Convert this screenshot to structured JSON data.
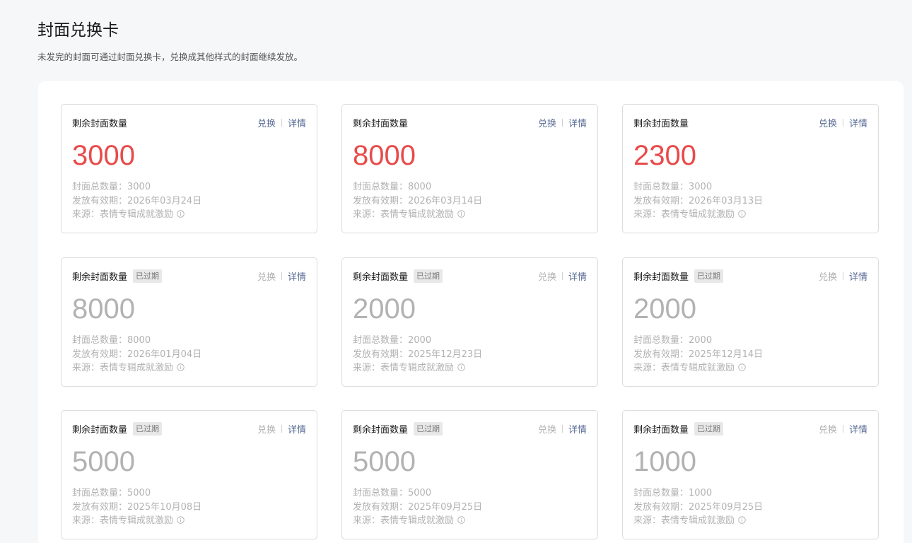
{
  "header": {
    "title": "封面兑换卡",
    "subtitle": "未发完的封面可通过封面兑换卡，兑换成其他样式的封面继续发放。"
  },
  "cards": [
    {
      "label": "剩余封面数量",
      "expired": false,
      "remaining": "3000",
      "exchange": "兑换",
      "details": "详情",
      "total": "封面总数量：3000",
      "validity": "发放有效期：2026年03月24日",
      "source": "来源：表情专辑成就激励"
    },
    {
      "label": "剩余封面数量",
      "expired": false,
      "remaining": "8000",
      "exchange": "兑换",
      "details": "详情",
      "total": "封面总数量：8000",
      "validity": "发放有效期：2026年03月14日",
      "source": "来源：表情专辑成就激励"
    },
    {
      "label": "剩余封面数量",
      "expired": false,
      "remaining": "2300",
      "exchange": "兑换",
      "details": "详情",
      "total": "封面总数量：3000",
      "validity": "发放有效期：2026年03月13日",
      "source": "来源：表情专辑成就激励"
    },
    {
      "label": "剩余封面数量",
      "expired": true,
      "badge": "已过期",
      "remaining": "8000",
      "exchange": "兑换",
      "details": "详情",
      "total": "封面总数量：8000",
      "validity": "发放有效期：2026年01月04日",
      "source": "来源：表情专辑成就激励"
    },
    {
      "label": "剩余封面数量",
      "expired": true,
      "badge": "已过期",
      "remaining": "2000",
      "exchange": "兑换",
      "details": "详情",
      "total": "封面总数量：2000",
      "validity": "发放有效期：2025年12月23日",
      "source": "来源：表情专辑成就激励"
    },
    {
      "label": "剩余封面数量",
      "expired": true,
      "badge": "已过期",
      "remaining": "2000",
      "exchange": "兑换",
      "details": "详情",
      "total": "封面总数量：2000",
      "validity": "发放有效期：2025年12月14日",
      "source": "来源：表情专辑成就激励"
    },
    {
      "label": "剩余封面数量",
      "expired": true,
      "badge": "已过期",
      "remaining": "5000",
      "exchange": "兑换",
      "details": "详情",
      "total": "封面总数量：5000",
      "validity": "发放有效期：2025年10月08日",
      "source": "来源：表情专辑成就激励"
    },
    {
      "label": "剩余封面数量",
      "expired": true,
      "badge": "已过期",
      "remaining": "5000",
      "exchange": "兑换",
      "details": "详情",
      "total": "封面总数量：5000",
      "validity": "发放有效期：2025年09月25日",
      "source": "来源：表情专辑成就激励"
    },
    {
      "label": "剩余封面数量",
      "expired": true,
      "badge": "已过期",
      "remaining": "1000",
      "exchange": "兑换",
      "details": "详情",
      "total": "封面总数量：1000",
      "validity": "发放有效期：2025年09月25日",
      "source": "来源：表情专辑成就激励"
    }
  ],
  "colors": {
    "accent_red": "#e94a4a",
    "link_blue": "#576b95",
    "muted_gray": "#b2b2b2"
  },
  "icons": {
    "source_info": "info-icon"
  }
}
